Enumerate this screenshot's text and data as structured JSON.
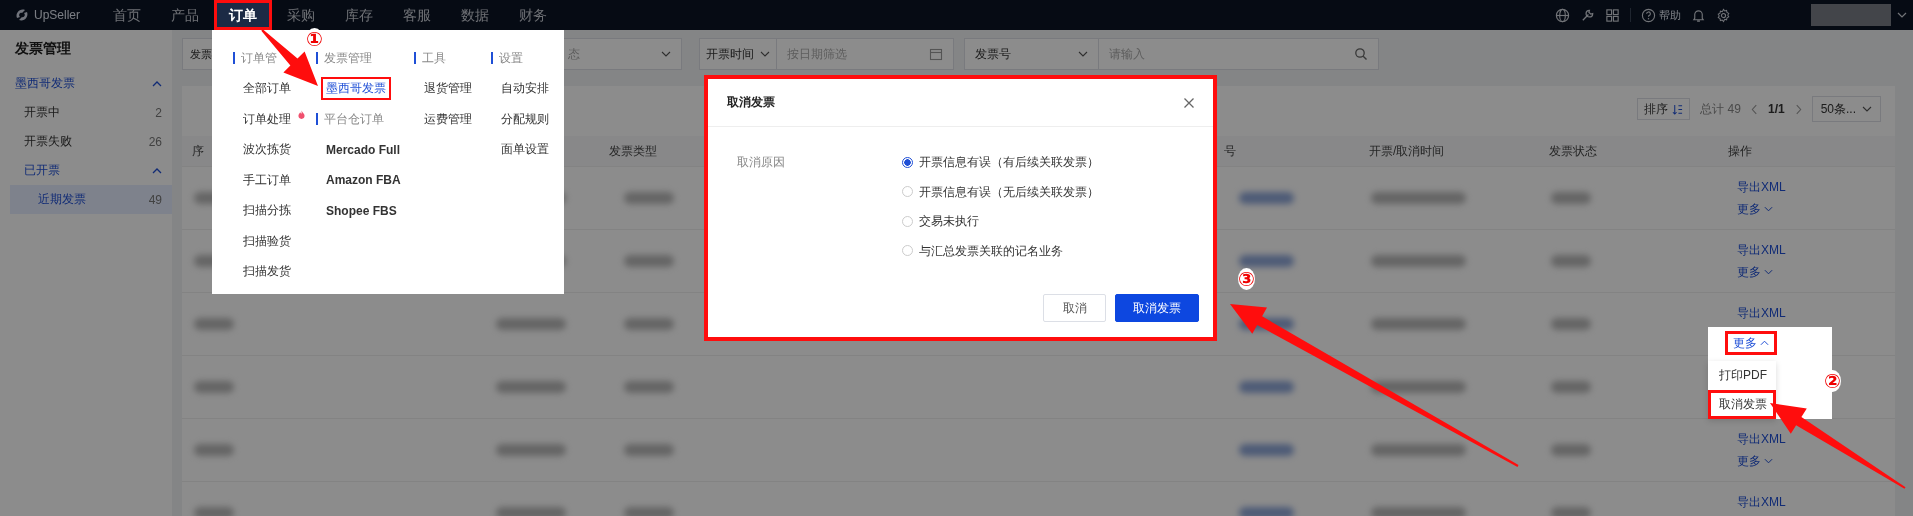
{
  "top_nav": {
    "logo": "UpSeller",
    "help": "帮助",
    "items": [
      {
        "label": "首页",
        "selected": false,
        "highlighted": false
      },
      {
        "label": "产品",
        "selected": false,
        "highlighted": false
      },
      {
        "label": "订单",
        "selected": true,
        "highlighted": true
      },
      {
        "label": "采购",
        "selected": false,
        "highlighted": false
      },
      {
        "label": "库存",
        "selected": false,
        "highlighted": false
      },
      {
        "label": "客服",
        "selected": false,
        "highlighted": false
      },
      {
        "label": "数据",
        "selected": false,
        "highlighted": false
      },
      {
        "label": "财务",
        "selected": false,
        "highlighted": false
      }
    ]
  },
  "sidebar": {
    "title": "发票管理",
    "items": [
      {
        "label": "墨西哥发票",
        "expanded": true,
        "children": [
          {
            "label": "开票中",
            "count": "2",
            "selected": false
          },
          {
            "label": "开票失败",
            "count": "26",
            "selected": false
          },
          {
            "label": "已开票",
            "expanded": true,
            "children": [
              {
                "label": "近期发票",
                "count": "49",
                "selected": true
              }
            ]
          }
        ]
      }
    ]
  },
  "filters": [
    {
      "kind": "select",
      "value": "发票"
    },
    {
      "kind": "select",
      "placeholder": "态"
    },
    {
      "kind": "select_date",
      "label": "开票时间",
      "placeholder": "按日期筛选"
    },
    {
      "kind": "select_input",
      "label": "发票号",
      "placeholder": "请输入"
    }
  ],
  "toolbar": {
    "sort": "排序",
    "total": "总计 49",
    "page": "1/1",
    "page_size": "50条..."
  },
  "table": {
    "columns": [
      "序",
      "发票类型",
      "号",
      "开票/取消时间",
      "发票状态",
      "操作"
    ],
    "rows": [
      {
        "export": "导出XML",
        "more": "更多",
        "menu_open": false
      },
      {
        "export": "导出XML",
        "more": "更多",
        "menu_open": false
      },
      {
        "export": "导出XML",
        "more": "更多",
        "menu_open": true,
        "more_highlighted": true,
        "menu": [
          {
            "label": "打印PDF",
            "highlighted": false
          },
          {
            "label": "取消发票",
            "highlighted": true
          }
        ]
      },
      {
        "menu_open": false
      },
      {
        "export": "导出XML",
        "more": "更多",
        "menu_open": false
      },
      {
        "export": "导出XML",
        "menu_open": false
      }
    ]
  },
  "nav_menu": {
    "columns": [
      {
        "entries": [
          {
            "kind": "header",
            "label": "订单管"
          },
          {
            "kind": "link",
            "label": "全部订单",
            "selected": false,
            "highlighted": false,
            "hot": false
          },
          {
            "kind": "link",
            "label": "订单处理",
            "selected": false,
            "highlighted": false,
            "hot": true
          },
          {
            "kind": "link",
            "label": "波次拣货",
            "selected": false,
            "highlighted": false,
            "hot": false
          },
          {
            "kind": "link",
            "label": "手工订单",
            "selected": false,
            "highlighted": false,
            "hot": false
          },
          {
            "kind": "link",
            "label": "扫描分拣",
            "selected": false,
            "highlighted": false,
            "hot": false
          },
          {
            "kind": "link",
            "label": "扫描验货",
            "selected": false,
            "highlighted": false,
            "hot": false
          },
          {
            "kind": "link",
            "label": "扫描发货",
            "selected": false,
            "highlighted": false,
            "hot": false
          }
        ]
      },
      {
        "entries": [
          {
            "kind": "header",
            "label": "发票管理"
          },
          {
            "kind": "link",
            "label": "墨西哥发票",
            "selected": true,
            "highlighted": true,
            "hot": false
          },
          {
            "kind": "header",
            "label": "平台仓订单"
          },
          {
            "kind": "link",
            "label": "Mercado Full",
            "selected": false,
            "highlighted": false,
            "hot": false
          },
          {
            "kind": "link",
            "label": "Amazon FBA",
            "selected": false,
            "highlighted": false,
            "hot": false
          },
          {
            "kind": "link",
            "label": "Shopee FBS",
            "selected": false,
            "highlighted": false,
            "hot": false
          }
        ]
      },
      {
        "entries": [
          {
            "kind": "header",
            "label": "工具"
          },
          {
            "kind": "link",
            "label": "退货管理",
            "selected": false,
            "highlighted": false,
            "hot": false
          },
          {
            "kind": "link",
            "label": "运费管理",
            "selected": false,
            "highlighted": false,
            "hot": false
          }
        ]
      },
      {
        "entries": [
          {
            "kind": "header",
            "label": "设置"
          },
          {
            "kind": "link",
            "label": "自动安排",
            "selected": false,
            "highlighted": false,
            "hot": false
          },
          {
            "kind": "link",
            "label": "分配规则",
            "selected": false,
            "highlighted": false,
            "hot": false
          },
          {
            "kind": "link",
            "label": "面单设置",
            "selected": false,
            "highlighted": false,
            "hot": false
          }
        ]
      }
    ]
  },
  "modal": {
    "title": "取消发票",
    "highlighted": true,
    "field_label": "取消原因",
    "options": [
      {
        "label": "开票信息有误（有后续关联发票）",
        "selected": true
      },
      {
        "label": "开票信息有误（无后续关联发票）",
        "selected": false
      },
      {
        "label": "交易未执行",
        "selected": false
      },
      {
        "label": "与汇总发票关联的记名业务",
        "selected": false
      }
    ],
    "buttons": [
      {
        "label": "取消",
        "kind": "secondary"
      },
      {
        "label": "取消发票",
        "kind": "primary"
      }
    ]
  },
  "annotations": [
    {
      "label": "①"
    },
    {
      "label": "②"
    },
    {
      "label": "③"
    }
  ]
}
